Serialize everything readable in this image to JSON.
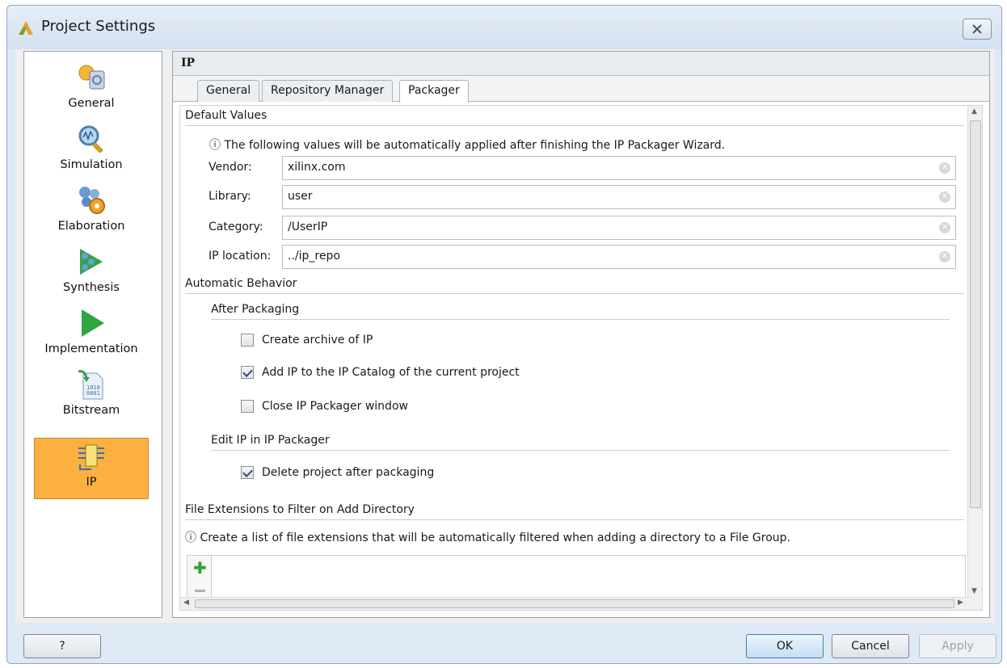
{
  "window": {
    "title": "Project Settings",
    "close_glyph": "✕"
  },
  "sidebar": {
    "items": [
      {
        "label": "General",
        "icon": "general-settings-icon"
      },
      {
        "label": "Simulation",
        "icon": "simulation-magnifier-icon"
      },
      {
        "label": "Elaboration",
        "icon": "elaboration-gears-icon"
      },
      {
        "label": "Synthesis",
        "icon": "synthesis-arrows-icon"
      },
      {
        "label": "Implementation",
        "icon": "implementation-play-icon"
      },
      {
        "label": "Bitstream",
        "icon": "bitstream-file-icon"
      },
      {
        "label": "IP",
        "icon": "ip-chip-icon",
        "selected": true
      }
    ]
  },
  "panel": {
    "title": "IP",
    "tabs": [
      "General",
      "Repository Manager",
      "Packager"
    ],
    "active_tab": "Packager"
  },
  "packager": {
    "default_values": {
      "heading": "Default Values",
      "info": "The following values will be automatically applied after finishing the IP Packager Wizard.",
      "fields": [
        {
          "label": "Vendor:",
          "value": "xilinx.com"
        },
        {
          "label": "Library:",
          "value": "user"
        },
        {
          "label": "Category:",
          "value": "/UserIP"
        },
        {
          "label": "IP location:",
          "value": "../ip_repo"
        }
      ]
    },
    "automatic_behavior": {
      "heading": "Automatic Behavior",
      "after_packaging": {
        "heading": "After Packaging",
        "options": [
          {
            "label": "Create archive of IP",
            "checked": false
          },
          {
            "label": "Add IP to the IP Catalog of the current project",
            "checked": true
          },
          {
            "label": "Close IP Packager window",
            "checked": false
          }
        ]
      },
      "edit_ip": {
        "heading": "Edit IP in IP Packager",
        "options": [
          {
            "label": "Delete project after packaging",
            "checked": true
          }
        ]
      }
    },
    "file_extensions": {
      "heading": "File Extensions to Filter on Add Directory",
      "info": "Create a list of file extensions that will be automatically filtered when adding a directory to a File Group."
    }
  },
  "footer": {
    "help": "?",
    "ok": "OK",
    "cancel": "Cancel",
    "apply": "Apply"
  },
  "colors": {
    "selected_nav": "#fbb040",
    "checkmark": "#2c4f86",
    "add_icon": "#2fa12f"
  }
}
